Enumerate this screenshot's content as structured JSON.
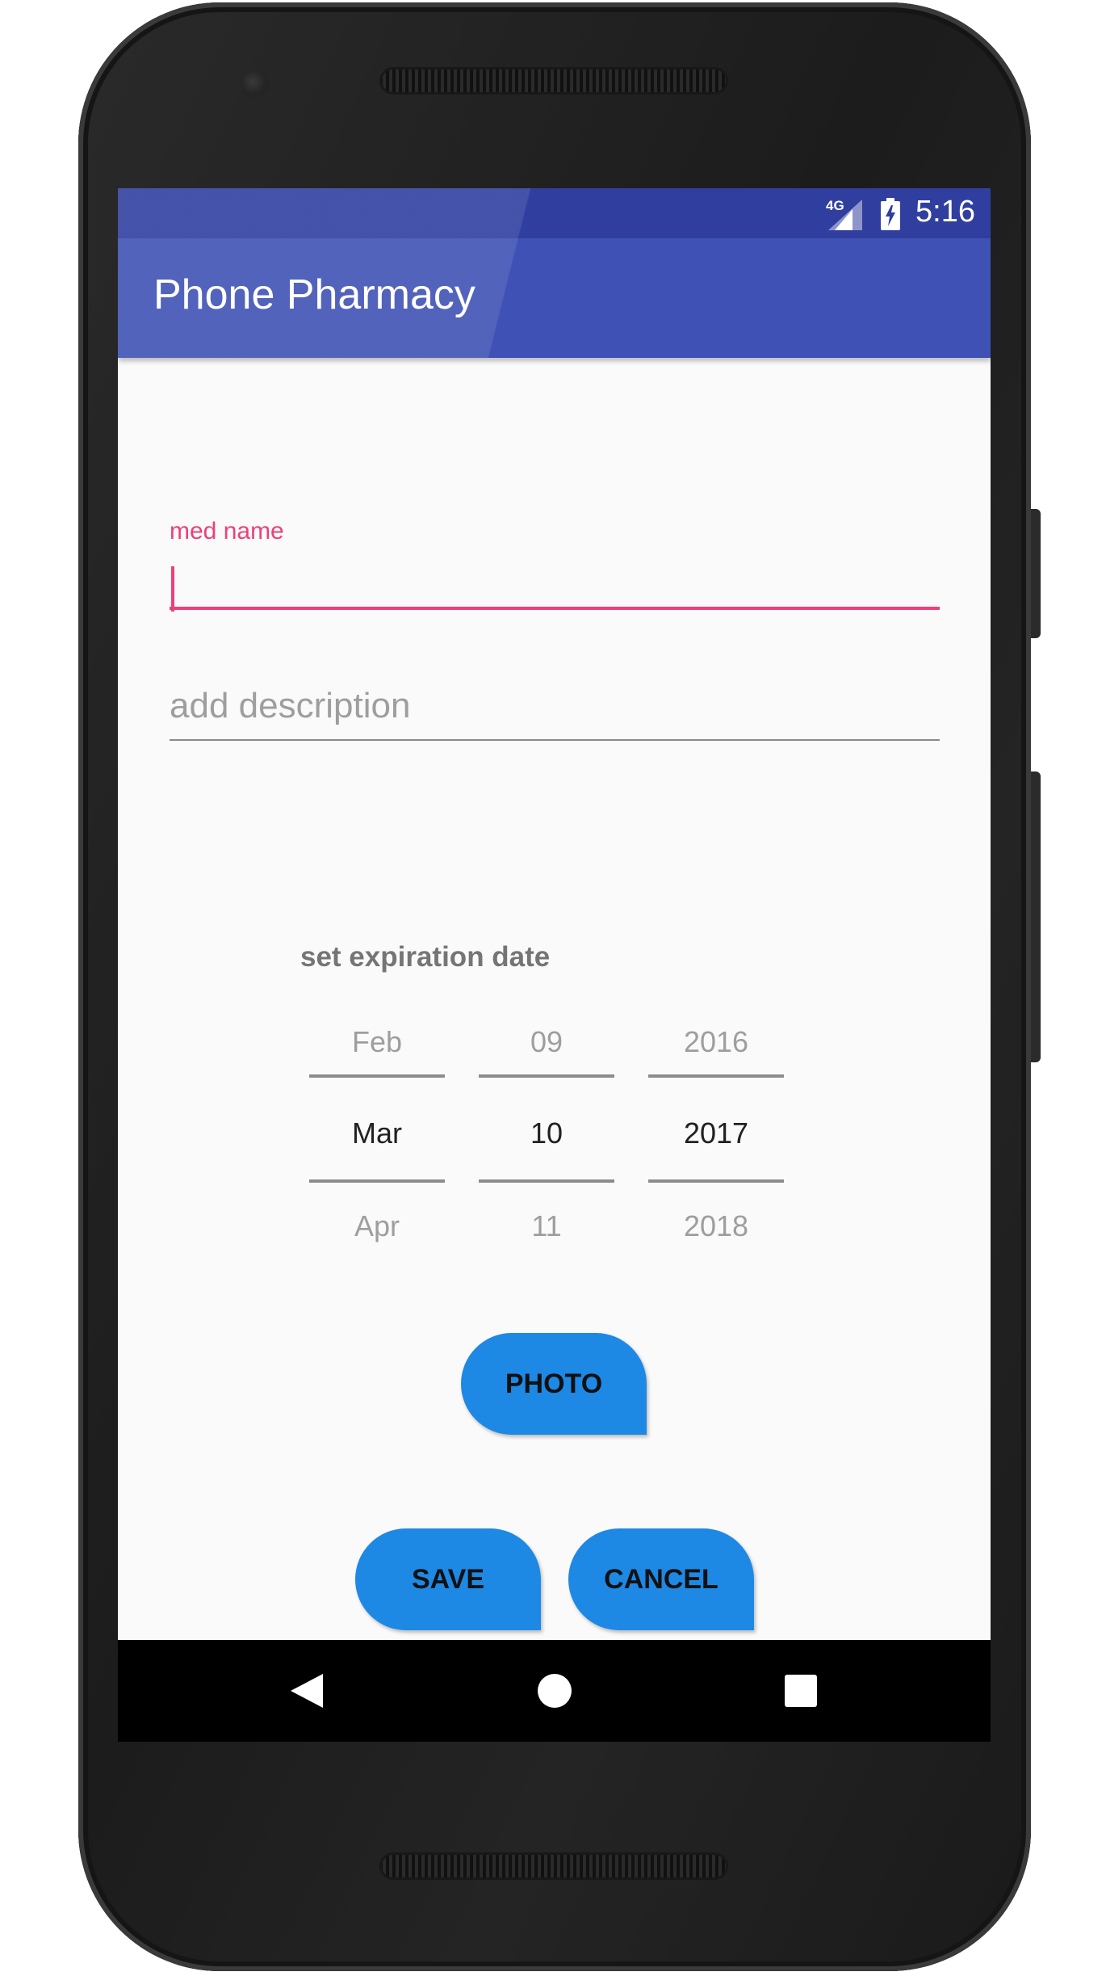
{
  "status_bar": {
    "network_label": "4G",
    "time": "5:16",
    "signal_icon": "cellular-signal-icon",
    "battery_icon": "battery-charging-icon",
    "color": "#303f9f"
  },
  "app_bar": {
    "title": "Phone Pharmacy",
    "color": "#3f51b5"
  },
  "form": {
    "med_name_label": "med name",
    "med_name_value": "",
    "description_placeholder": "add description",
    "description_value": "",
    "accent_color": "#ec407a"
  },
  "expiration": {
    "label": "set expiration date",
    "month": {
      "prev": "Feb",
      "current": "Mar",
      "next": "Apr"
    },
    "day": {
      "prev": "09",
      "current": "10",
      "next": "11"
    },
    "year": {
      "prev": "2016",
      "current": "2017",
      "next": "2018"
    }
  },
  "buttons": {
    "photo": "PHOTO",
    "save": "SAVE",
    "cancel": "CANCEL",
    "color": "#1e88e5"
  },
  "nav_bar": {
    "back_icon": "back-triangle-icon",
    "home_icon": "home-circle-icon",
    "recents_icon": "recents-square-icon"
  }
}
